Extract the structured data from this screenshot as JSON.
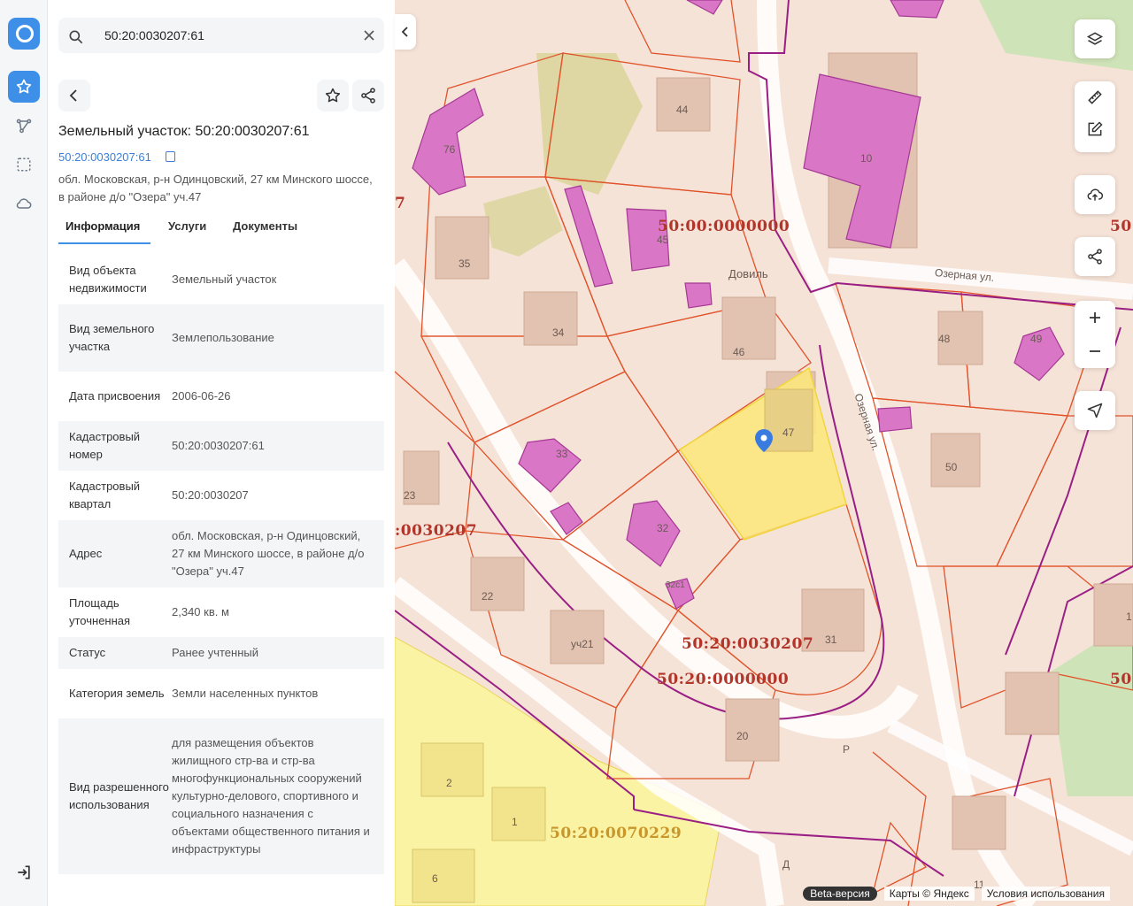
{
  "search": {
    "query": "50:20:0030207:61"
  },
  "object": {
    "title": "Земельный участок: 50:20:0030207:61",
    "cadastral_link": "50:20:0030207:61",
    "address": "обл. Московская, р-н Одинцовский, 27 км Минского шоссе, в районе д/о \"Озера\" уч.47"
  },
  "tabs": [
    {
      "label": "Информация",
      "active": true
    },
    {
      "label": "Услуги",
      "active": false
    },
    {
      "label": "Документы",
      "active": false
    }
  ],
  "info_rows": [
    {
      "key": "Вид объекта недвижимости",
      "value": "Земельный участок"
    },
    {
      "key": "Вид земельного участка",
      "value": "Землепользование"
    },
    {
      "key": "Дата присвоения",
      "value": "2006-06-26"
    },
    {
      "key": "Кадастровый номер",
      "value": "50:20:0030207:61"
    },
    {
      "key": "Кадастровый квартал",
      "value": "50:20:0030207"
    },
    {
      "key": "Адрес",
      "value": "обл. Московская, р-н Одинцовский, 27 км Минского шоссе, в районе д/о \"Озера\" уч.47"
    },
    {
      "key": "Площадь уточненная",
      "value": "2,340 кв. м"
    },
    {
      "key": "Статус",
      "value": "Ранее учтенный"
    },
    {
      "key": "Категория земель",
      "value": "Земли населенных пунктов"
    },
    {
      "key": "Вид разрешенного использования",
      "value": "для размещения объектов жилищного стр-ва и стр-ва многофункциональных сооружений культурно-делового, спортивного и социального назначения с объектами общественного питания и инфраструктуры"
    }
  ],
  "map": {
    "labels": {
      "l1": "50:00:0000000",
      "l2": "50:20:0030207",
      "l3": "50:20:0000000",
      "l4": "50:20:0070229",
      "l5": ":0030207",
      "l6": "50:",
      "l7": "50:",
      "l8": "7"
    },
    "streets": {
      "s1": "Озерная ул.",
      "s2": "Озерная ул.",
      "s3": "Довиль"
    },
    "numbers": [
      "44",
      "76",
      "10",
      "35",
      "45",
      "34",
      "46",
      "48",
      "49",
      "47",
      "50",
      "23",
      "32",
      "33",
      "22",
      "уч21",
      "32с1",
      "31",
      "20",
      "2",
      "1",
      "6",
      "11",
      "Р",
      "Д",
      "1"
    ]
  },
  "footer": {
    "beta": "Beta-версия",
    "copyright": "Карты © Яндекс",
    "terms": "Условия использования"
  },
  "colors": {
    "accent": "#3d8fe8",
    "parcel_border": "#e0532a",
    "selected_fill": "#fbe77a",
    "building": "#d977c6"
  }
}
